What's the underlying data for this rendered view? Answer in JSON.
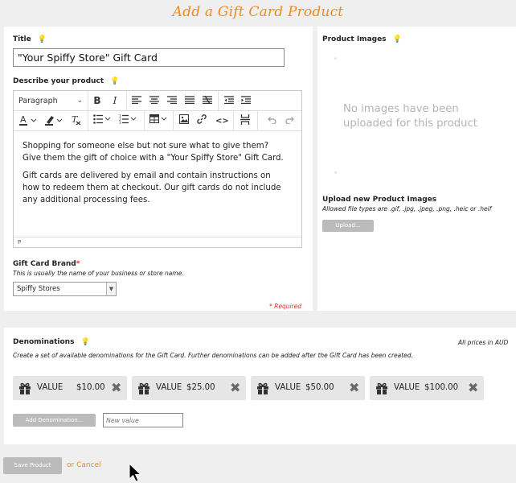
{
  "page": {
    "title": "Add a Gift Card Product"
  },
  "title_field": {
    "label": "Title",
    "value": "\"Your Spiffy Store\" Gift Card"
  },
  "description": {
    "label": "Describe your product",
    "paragraph_format": "Paragraph",
    "body": [
      "Shopping for someone else but not sure what to give them? Give them the gift of choice with a \"Your Spiffy Store\" Gift Card.",
      "Gift cards are delivered by email and contain instructions on how to redeem them at checkout. Our gift cards do not include any additional processing fees."
    ],
    "status_path": "P",
    "toolbar_icons": [
      "bold-icon",
      "italic-icon",
      "align-left-icon",
      "align-center-icon",
      "align-right-icon",
      "align-justify-icon",
      "clear-format-icon",
      "outdent-icon",
      "indent-icon",
      "text-color-icon",
      "highlight-icon",
      "remove-format-icon",
      "bullet-list-icon",
      "numbered-list-icon",
      "table-icon",
      "image-icon",
      "link-icon",
      "code-icon",
      "page-break-icon",
      "undo-icon",
      "redo-icon"
    ]
  },
  "brand": {
    "label": "Gift Card Brand",
    "required_mark": "*",
    "help": "This is usually the name of your business or store name.",
    "selected": "Spiffy Stores",
    "required_note": "* Required"
  },
  "images": {
    "label": "Product Images",
    "empty_text": "No images have been uploaded for this product",
    "upload_label": "Upload new Product Images",
    "allowed_types": "Allowed file types are .gif, .jpg, .jpeg, .png, .heic or .heif",
    "upload_button": "Upload..."
  },
  "denominations": {
    "label": "Denominations",
    "prices_note": "All prices in AUD",
    "help": "Create a set of available denominations for the Gift Card. Further denominations can be added after the Gift Card has been created.",
    "items": [
      {
        "label": "VALUE",
        "amount": "$10.00"
      },
      {
        "label": "VALUE",
        "amount": "$25.00"
      },
      {
        "label": "VALUE",
        "amount": "$50.00"
      },
      {
        "label": "VALUE",
        "amount": "$100.00"
      }
    ],
    "add_button": "Add Denomination...",
    "new_value_placeholder": "New value"
  },
  "actions": {
    "save": "Save Product",
    "cancel": "or Cancel"
  },
  "colors": {
    "accent": "#f08a1c",
    "required": "#e03131",
    "button_disabled": "#bbbbbb",
    "panel_bg": "#ffffff",
    "page_bg": "#efefef"
  }
}
